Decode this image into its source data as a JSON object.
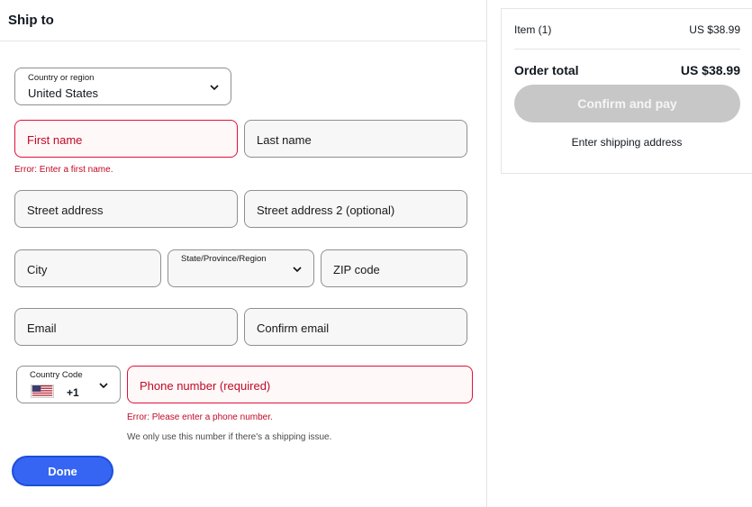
{
  "ship_to": {
    "title": "Ship to",
    "country_label": "Country or region",
    "country_value": "United States",
    "first_name_placeholder": "First name",
    "first_name_error": "Error: Enter a first name.",
    "last_name_placeholder": "Last name",
    "street_placeholder": "Street address",
    "street2_placeholder": "Street address 2 (optional)",
    "city_placeholder": "City",
    "state_label": "State/Province/Region",
    "zip_placeholder": "ZIP code",
    "email_placeholder": "Email",
    "confirm_email_placeholder": "Confirm email",
    "country_code_label": "Country Code",
    "country_code_value": "+1",
    "country_code_flag": "us-flag-icon",
    "phone_placeholder": "Phone number (required)",
    "phone_error": "Error: Please enter a phone number.",
    "phone_hint": "We only use this number if there's a shipping issue.",
    "done_label": "Done"
  },
  "summary": {
    "item_label": "Item (1)",
    "item_price": "US $38.99",
    "total_label": "Order total",
    "total_price": "US $38.99",
    "confirm_label": "Confirm and pay",
    "shipping_hint": "Enter shipping address"
  },
  "colors": {
    "accent": "#3665f3",
    "error": "#c00a26",
    "disabled_button": "#c7c7c7"
  }
}
